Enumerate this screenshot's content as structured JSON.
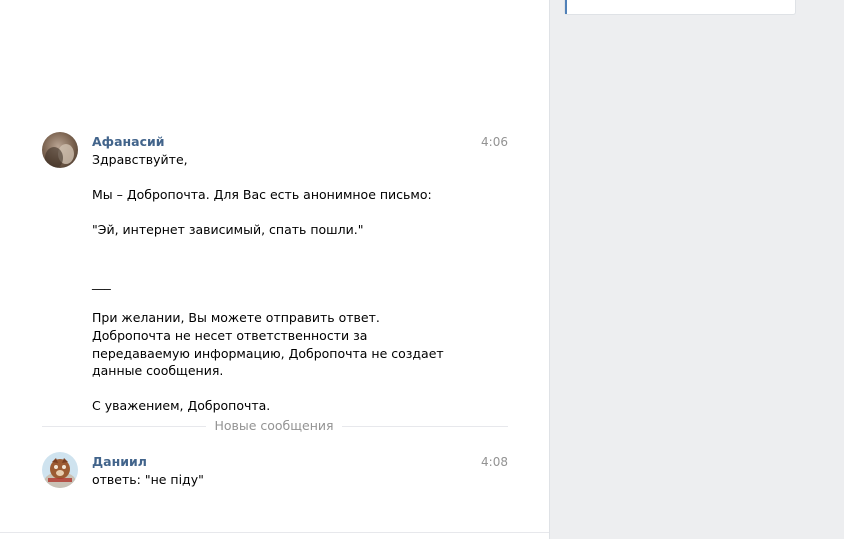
{
  "messages": [
    {
      "author": "Афанасий",
      "time": "4:06",
      "avatar_icon": "user-avatar-photo",
      "lines": [
        "Здравствуйте,",
        "",
        "Мы – Добропочта. Для Вас есть анонимное письмо:",
        "",
        "\"Эй, интернет зависимый, спать пошли.\"",
        "",
        "",
        "___",
        "",
        "При желании, Вы можете отправить ответ.",
        "Добропочта не несет ответственности за",
        "передаваемую информацию, Добропочта не создает",
        "данные сообщения.",
        "",
        "С уважением, Добропочта."
      ]
    },
    {
      "author": "Даниил",
      "time": "4:08",
      "avatar_icon": "user-avatar-photo",
      "lines": [
        "ответь: \"не піду\""
      ]
    }
  ],
  "new_messages_divider": "Новые сообщения",
  "colors": {
    "author_link": "#42648b",
    "time_text": "#939393",
    "background": "#edeef0",
    "accent": "#5181b8"
  }
}
